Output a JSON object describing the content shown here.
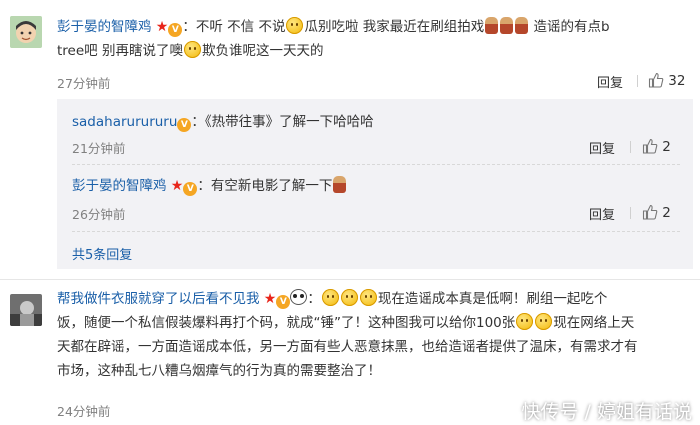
{
  "comments": [
    {
      "user": "彭于晏的智障鸡",
      "sep": "：",
      "text_parts": [
        "不听 不信 不说",
        "瓜别吃啦 我家最近在刷组拍戏",
        "造谣的有点b",
        "tree吧 别再瞎说了噢",
        "欺负谁呢这一天天的"
      ],
      "time": "27分钟前",
      "reply_label": "回复",
      "likes": "32"
    },
    {
      "user": "帮我做件衣服就穿了以后看不见我",
      "sep": "：",
      "text_parts": [
        "现在造谣成本真是低啊！刷组一起吃个",
        "饭，随便一个私信假装爆料再打个码，就成“锤”了！这种图我可以给你100张",
        "现在网络上天",
        "天都在辟谣，一方面造谣成本低，另一方面有些人恶意抹黑，也给造谣者提供了温床，有需求才有",
        "市场，这种乱七八糟乌烟瘴气的行为真的需要整治了！"
      ],
      "time": "24分钟前"
    }
  ],
  "replies": [
    {
      "user": "sadaharurururu",
      "sep": "：",
      "text": "《热带往事》了解一下哈哈哈",
      "time": "21分钟前",
      "reply_label": "回复",
      "likes": "2"
    },
    {
      "user": "彭于晏的智障鸡",
      "sep": "：",
      "text": "有空新电影了解一下",
      "time": "26分钟前",
      "reply_label": "回复",
      "likes": "2"
    }
  ],
  "more_replies": "共5条回复",
  "watermark": "快传号 / 婷姐有话说",
  "badge_text": "V"
}
